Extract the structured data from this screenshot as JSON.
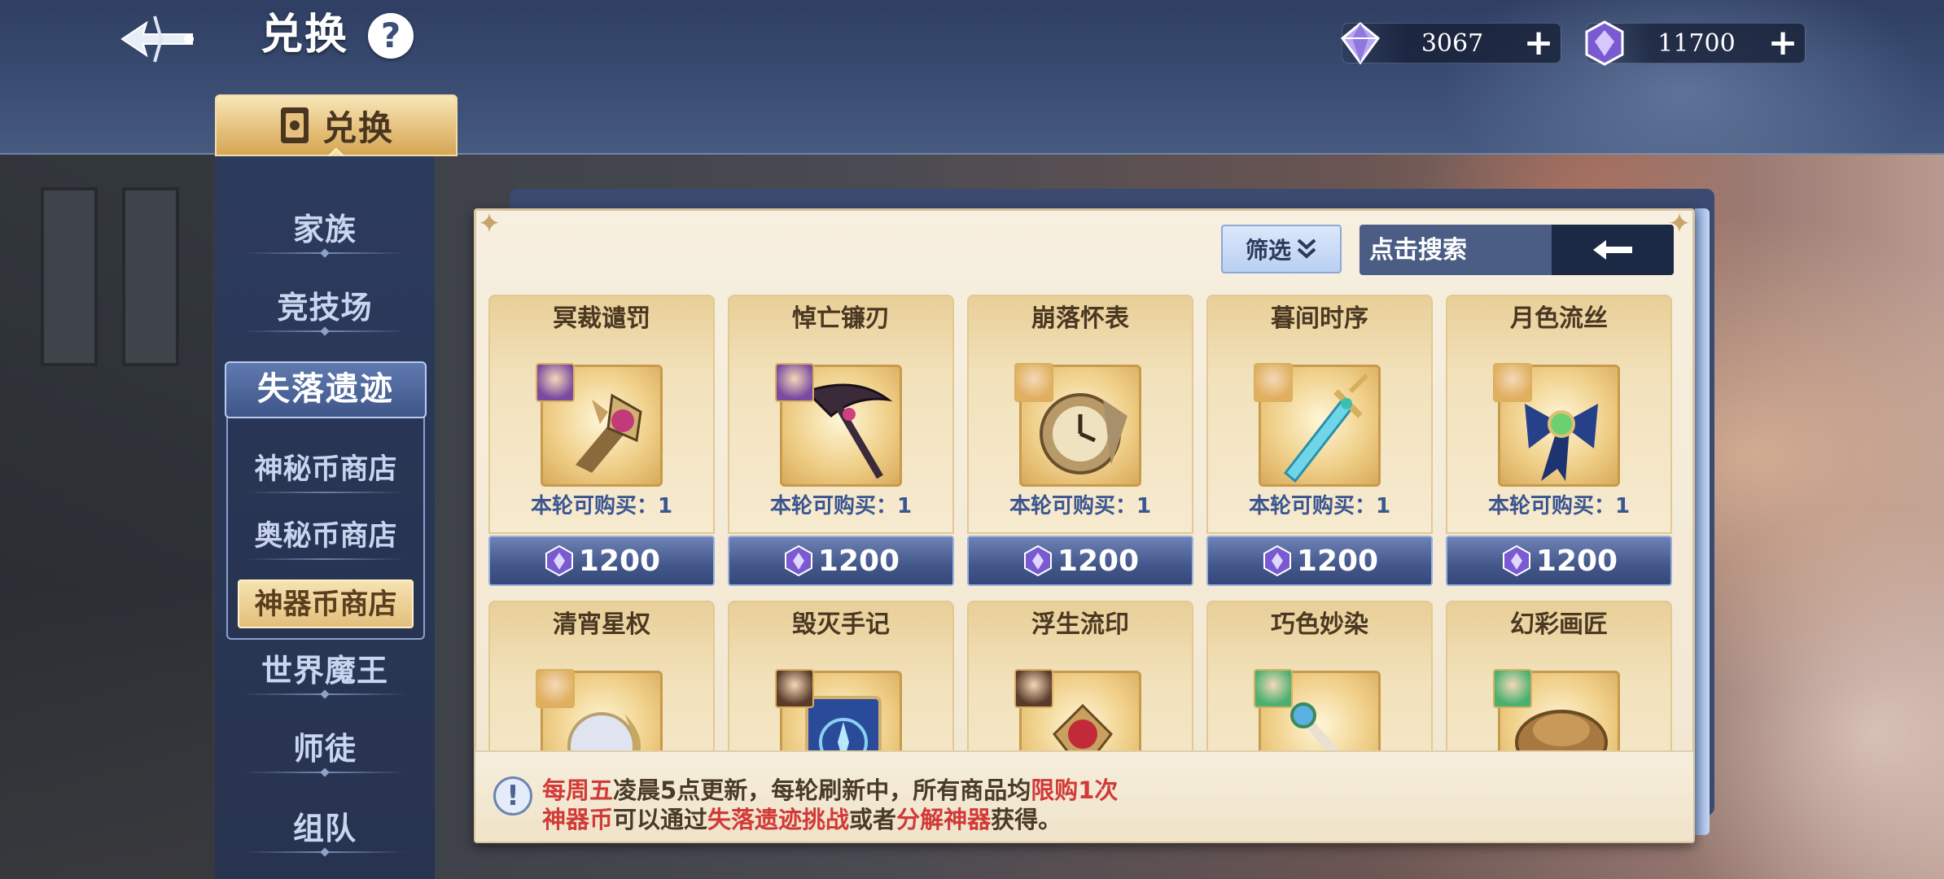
{
  "header": {
    "title": "兑换",
    "help": "?",
    "currencies": [
      {
        "name": "diamond",
        "value": "3067",
        "plus": "+"
      },
      {
        "name": "crystal-coin",
        "value": "11700",
        "plus": "+"
      }
    ]
  },
  "main_tab": {
    "label": "兑换"
  },
  "sidebar": {
    "items": [
      {
        "label": "家族"
      },
      {
        "label": "竞技场"
      },
      {
        "label": "失落遗迹"
      },
      {
        "label": "世界魔王"
      },
      {
        "label": "师徒"
      },
      {
        "label": "组队"
      }
    ],
    "subitems": [
      {
        "label": "神秘币商店"
      },
      {
        "label": "奥秘币商店"
      },
      {
        "label": "神器币商店"
      }
    ]
  },
  "toolbar": {
    "filter_label": "筛选",
    "search_placeholder": "点击搜索"
  },
  "items": [
    {
      "name": "冥裁谴罚",
      "limit": "本轮可购买：1",
      "price": "1200",
      "icon": "dark-scepter-icon",
      "portrait_color": "#7a4aa0"
    },
    {
      "name": "悼亡镰刃",
      "limit": "本轮可购买：1",
      "price": "1200",
      "icon": "scythe-icon",
      "portrait_color": "#7a4aa0"
    },
    {
      "name": "崩落怀表",
      "limit": "本轮可购买：1",
      "price": "1200",
      "icon": "pocket-watch-icon",
      "portrait_color": "#e0b060"
    },
    {
      "name": "暮间时序",
      "limit": "本轮可购买：1",
      "price": "1200",
      "icon": "crystal-sword-icon",
      "portrait_color": "#e0b060"
    },
    {
      "name": "月色流丝",
      "limit": "本轮可购买：1",
      "price": "1200",
      "icon": "ribbon-bow-icon",
      "portrait_color": "#e0b060"
    },
    {
      "name": "清宵星权",
      "limit": "",
      "price": "",
      "icon": "moon-staff-icon",
      "portrait_color": "#e0b060"
    },
    {
      "name": "毁灭手记",
      "limit": "",
      "price": "",
      "icon": "spell-book-icon",
      "portrait_color": "#5a3a2a"
    },
    {
      "name": "浮生流印",
      "limit": "",
      "price": "",
      "icon": "ruby-seal-icon",
      "portrait_color": "#5a3a2a"
    },
    {
      "name": "巧色妙染",
      "limit": "",
      "price": "",
      "icon": "paint-brush-icon",
      "portrait_color": "#4ab070"
    },
    {
      "name": "幻彩画匠",
      "limit": "",
      "price": "",
      "icon": "painter-hat-icon",
      "portrait_color": "#4ab070"
    }
  ],
  "notice": {
    "line1_a": "每周五",
    "line1_b": "凌晨5点更新，每轮刷新中，所有商品均",
    "line1_c": "限购1次",
    "line2_a": "神器币",
    "line2_b": "可以通过",
    "line2_c": "失落遗迹挑战",
    "line2_d": "或者",
    "line2_e": "分解神器",
    "line2_f": "获得。"
  },
  "colors": {
    "accent_red": "#d23a38",
    "gold": "#e6c27e",
    "navy": "#2f3f63"
  }
}
